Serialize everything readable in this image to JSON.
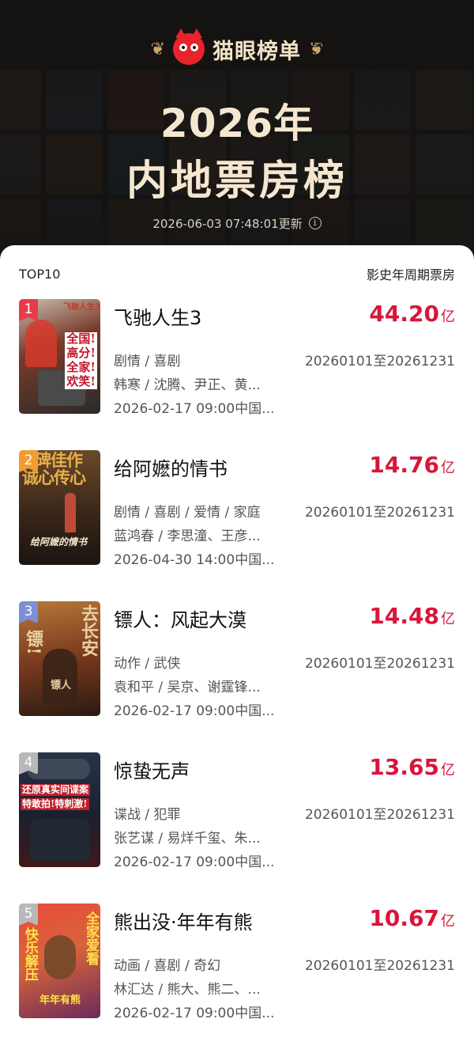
{
  "brand": {
    "name": "猫眼榜单",
    "laurel_color": "#c9a46b",
    "logo_color": "#e8232c"
  },
  "title": {
    "year": "2026年",
    "main": "内地票房榜"
  },
  "update_text": "2026-06-03 07:48:01更新",
  "info_icon": "i",
  "list_header": {
    "left": "TOP10",
    "right": "影史年周期票房"
  },
  "colors": {
    "box_office": "#d8163a",
    "title_gold": "#f5e7cf"
  },
  "movies": [
    {
      "rank": "1",
      "badge_color": "#e83b4a",
      "name": "飞驰人生3",
      "box": "44.20",
      "unit": "亿",
      "genre": "剧情 / 喜剧",
      "period": "20260101至20261231",
      "cast": "韩寒 / 沈腾、尹正、黄...",
      "release": "2026-02-17 09:00中国...",
      "poster_text": [
        "全国!",
        "高分!",
        "全家!",
        "欢笑!"
      ],
      "poster_top": "飞驰人生3"
    },
    {
      "rank": "2",
      "badge_color": "#f29b34",
      "name": "给阿嬷的情书",
      "box": "14.76",
      "unit": "亿",
      "genre": "剧情 / 喜剧 / 爱情 / 家庭",
      "period": "20260101至20261231",
      "cast": "蓝鸿春 / 李思潼、王彦...",
      "release": "2026-04-30 14:00中国...",
      "poster_text": [
        "碑佳作",
        "诚心传心"
      ],
      "poster_top": "给阿嬷的情书"
    },
    {
      "rank": "3",
      "badge_color": "#7d8fd6",
      "name": "镖人：风起大漠",
      "box": "14.48",
      "unit": "亿",
      "genre": "动作 / 武侠",
      "period": "20260101至20261231",
      "cast": "袁和平 / 吴京、谢霆锋...",
      "release": "2026-02-17 09:00中国...",
      "poster_text": [
        "去长安",
        "镖!"
      ],
      "poster_top": "镖人"
    },
    {
      "rank": "4",
      "badge_color": "#b8b8b8",
      "name": "惊蛰无声",
      "box": "13.65",
      "unit": "亿",
      "genre": "谍战 / 犯罪",
      "period": "20260101至20261231",
      "cast": "张艺谋 / 易烊千玺、朱...",
      "release": "2026-02-17 09:00中国...",
      "poster_text": [
        "还原真实间谍案",
        "特敢拍!特刺激!"
      ],
      "poster_top": ""
    },
    {
      "rank": "5",
      "badge_color": "#b8b8b8",
      "name": "熊出没·年年有熊",
      "box": "10.67",
      "unit": "亿",
      "genre": "动画 / 喜剧 / 奇幻",
      "period": "20260101至20261231",
      "cast": "林汇达 / 熊大、熊二、...",
      "release": "2026-02-17 09:00中国...",
      "poster_text": [
        "全家爱看",
        "快乐解压"
      ],
      "poster_top": "年年有熊"
    }
  ]
}
